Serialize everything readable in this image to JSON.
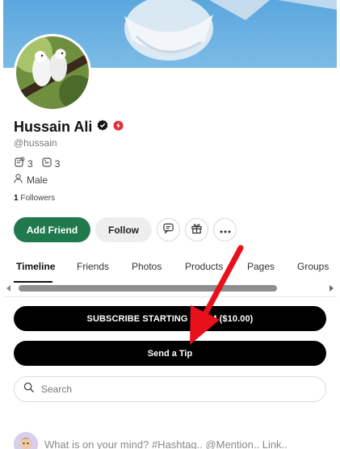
{
  "profile": {
    "name": "Hussain Ali",
    "handle": "@hussain",
    "posts_count": "3",
    "albums_count": "3",
    "gender": "Male",
    "followers_count": "1",
    "followers_label": "Followers"
  },
  "actions": {
    "add_friend_label": "Add Friend",
    "follow_label": "Follow"
  },
  "tabs": [
    {
      "label": "Timeline"
    },
    {
      "label": "Friends"
    },
    {
      "label": "Photos"
    },
    {
      "label": "Products"
    },
    {
      "label": "Pages"
    },
    {
      "label": "Groups"
    }
  ],
  "buttons": {
    "subscribe_label": "SUBSCRIBE STARTING FROM ($10.00)",
    "tip_label": "Send a Tip"
  },
  "search": {
    "placeholder": "Search"
  },
  "composer": {
    "placeholder": "What is on your mind? #Hashtag.. @Mention.. Link.."
  },
  "colors": {
    "accent_green": "#20794d",
    "annotation_arrow": "#e8101a"
  },
  "icons": [
    "verified-icon",
    "pro-badge-icon",
    "posts-icon",
    "albums-icon",
    "user-icon",
    "message-icon",
    "gift-icon",
    "more-icon",
    "search-icon",
    "arrow-annotation"
  ]
}
